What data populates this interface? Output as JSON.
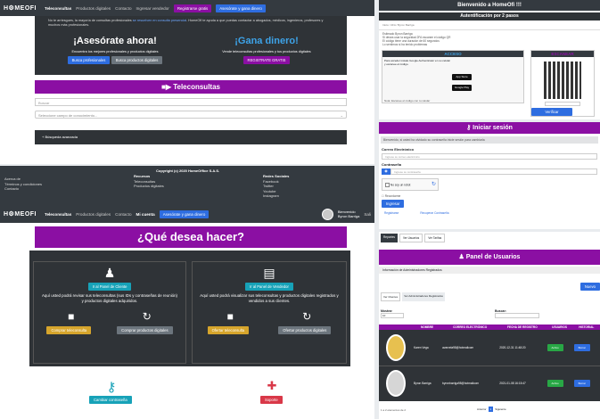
{
  "nav": {
    "logo": "H⚙MEOFI",
    "links": [
      "Teleconsultas",
      "Productos digitales",
      "Contacto",
      "Ingresar vendedor"
    ],
    "register_btn": "Registrarse gratis",
    "advise_btn": "Asesórate y gana dinero"
  },
  "nav2": {
    "logo": "H⚙MEOFI",
    "links": [
      "Teleconsultas",
      "Productos digitales",
      "Contacto",
      "Mi cuenta"
    ],
    "advise_btn": "Asesórate y gana dinero",
    "welcome": "Bienvenido",
    "user": "Byron Barriga",
    "exit": "Sali"
  },
  "hero": {
    "intro": "No te arriesgues, la mayoría de consultas profesionales",
    "intro_link": "se resuelven en consulta presencial",
    "intro_rest": ". HomeOfi te ayuda a que puedas contactar a abogados, médicos, ingenieros, profesores y muchos más profesionales.",
    "left_title": "¡Asesórate ahora!",
    "left_sub": "Encuentra los mejores profesionales y productos digitales",
    "btn_pros": "Busca profesionales",
    "btn_products": "Busca productos digitales",
    "right_title": "¡Gana dinero!",
    "right_sub": "Vende teleconsultas profesionales y tus productos digitales",
    "btn_register": "REGISTRATE GRATIS"
  },
  "teleconsultas": {
    "title": "Teleconsultas",
    "search_placeholder": "Buscar",
    "select_value": "Seleccione campo de conocimiento...",
    "advanced": "+ Búsqueda avanzada"
  },
  "footer": {
    "copyright": "Copyright (c) 2020 HomeOffice S.A.S.",
    "col1": [
      "Acerca de",
      "Términos y condiciones",
      "Contacto"
    ],
    "col2_title": "Recursos",
    "col2": [
      "Teleconsultas",
      "Productos digitales"
    ],
    "col3_title": "Redes Sociales",
    "col3": [
      "Facebook",
      "Twitter",
      "Youtube",
      "Instagram"
    ]
  },
  "what": {
    "title": "¿Qué desea hacer?",
    "client_btn": "Ir al Panel de Cliente",
    "client_text": "Aquí usted podrá revisar sus teleconsultas (sus IDs y contraseñas de reunión) y productos digitales adquiridos.",
    "vendor_btn": "Ir al Panel de Vendedor",
    "vendor_text": "Aquí usted podrá visualizar sus teleconsultas y productos digitales registrados y vendidos a sus clientes.",
    "buy_tele": "Comprar teleconsulta",
    "buy_prod": "Comprar productos digitales",
    "offer_tele": "Ofertar teleconsulta",
    "offer_prod": "Ofertar productos digitales",
    "change_pw": "Cambiar contraseña",
    "support": "Soporte"
  },
  "twofa": {
    "welcome": "Bienvenido a HomeOfi !!!",
    "title": "Autentificación por 2 pasos",
    "breadcrumb": "Inicio  /  2FA  /  Byron Barriga",
    "greet": "Estimado Byron Barriga",
    "lines": [
      "Si desea usar la seguridad 2FA escanee el código QR",
      "El código tiene una duración de 60 segundos",
      "Lo sentimos si ha tenido problemas"
    ],
    "access": "ACCESO",
    "access_text": "Para acceder instale Google Authenticator en su celular y escanee el código.",
    "scan": "ESCANEAR",
    "verify": "Verificar",
    "note": "Nota: Escanee el código con tu celular",
    "store1": "App Store",
    "store2": "Google Play"
  },
  "login": {
    "title": "Iniciar sesión",
    "info": "Bienvenido, si usted ha olvidado su contraseña inicie sesión para cambiarla",
    "email_label": "Correo Electrónico",
    "email_placeholder": "Ingrese su correo electrónico",
    "pw_label": "Contraseña",
    "pw_placeholder": "Ingrese su contraseña",
    "captcha": "No soy un robot",
    "remember": "Recordarme",
    "submit": "Ingresar",
    "register": "Registrarse",
    "forgot": "Recuperar Contraseña"
  },
  "admin": {
    "tabs": [
      "Reportes",
      "Ver Usuarios",
      "Ver Tarifas"
    ],
    "title": "Panel de Usuarios",
    "sub": "Información de Administradores Registrados",
    "new_btn": "Nuevo",
    "subtabs": [
      "Ver Clientes",
      "Ver Administradores Registrados"
    ],
    "show_label": "Mostrar",
    "show_value": "10",
    "search_label": "Buscar:",
    "headers": [
      "",
      "NOMBRE",
      "CORREO ELECTRÓNICO",
      "FECHA DE REGISTRO",
      "USUARIOS",
      "HISTORIAL"
    ],
    "rows": [
      {
        "name": "Karen Vega",
        "email": "avarvela98@hotmailcom",
        "date": "2020-12-31 11:48:20",
        "status": "Activo",
        "action": "Borrar"
      },
      {
        "name": "Byron Barriga",
        "email": "byronbarriga98@hotmailcom",
        "date": "2021-01-08 16:15:47",
        "status": "Activo",
        "action": "Borrar"
      }
    ],
    "footer_left": "1 a 2 elementos de 2",
    "prev": "Anterior",
    "page": "1",
    "next": "Siguiente"
  },
  "colors": {
    "purple": "#8b0fa3",
    "dark": "#343a40",
    "blue": "#2e6de0",
    "teal": "#17a2b8"
  }
}
